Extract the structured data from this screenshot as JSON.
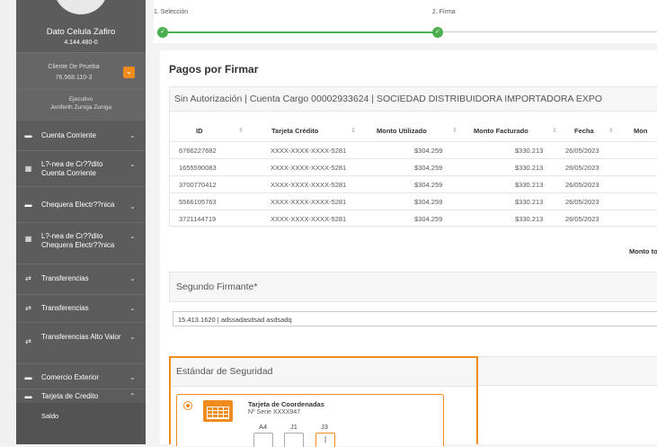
{
  "sidebar": {
    "user_name": "Dato Celula Zafiro",
    "user_rut": "4.144.480-0",
    "client_label": "Cliente De Prueba",
    "client_rut": "76.568.110-3",
    "client_toggle_icon": "⌄",
    "exec_label": "Ejecutivo",
    "exec_name": "Jeniferth Zuniga Zuniga",
    "items": [
      {
        "label": "Cuenta Corriente",
        "icon": "wallet-icon",
        "glyph": "▬",
        "chevron": "⌄"
      },
      {
        "label": "L?-nea de Cr??dito Cuenta Corriente",
        "icon": "grid-icon",
        "glyph": "▦",
        "chevron": "⌄"
      },
      {
        "label": "Chequera Electr??nica",
        "icon": "wallet-icon",
        "glyph": "▬",
        "chevron": "⌄"
      },
      {
        "label": "L?-nea de Cr??dito Chequera Electr??nica",
        "icon": "grid-icon",
        "glyph": "▦",
        "chevron": "⌄"
      },
      {
        "label": "Transferencias",
        "icon": "transfer-icon",
        "glyph": "⇄",
        "chevron": "⌄"
      },
      {
        "label": "Transferencias",
        "icon": "transfer-icon",
        "glyph": "⇄",
        "chevron": "⌄"
      },
      {
        "label": "Transferencias Alto Valor",
        "icon": "transfer-icon",
        "glyph": "⇄",
        "chevron": "⌄"
      },
      {
        "label": "Comercio Exterior",
        "icon": "wallet-icon",
        "glyph": "▬",
        "chevron": "⌄"
      },
      {
        "label": "Tarjeta de Credito",
        "icon": "wallet-icon",
        "glyph": "▬",
        "chevron": "⌃"
      }
    ],
    "sub_item": "Saldo"
  },
  "steps": {
    "step1": "1. Selección",
    "step2": "2. Firma",
    "check": "✓"
  },
  "main": {
    "title": "Pagos por Firmar",
    "account_header": "Sin Autorización | Cuenta Cargo 00002933624 | SOCIEDAD DISTRIBUIDORA IMPORTADORA EXPO",
    "sort_glyph": "⇕",
    "columns": [
      "ID",
      "Tarjeta Crédito",
      "Monto Utilizado",
      "Monto Facturado",
      "Fecha",
      "Mon"
    ],
    "rows": [
      [
        "6766227682",
        "XXXX-XXXX-XXXX-5281",
        "$304.259",
        "$330.213",
        "26/05/2023"
      ],
      [
        "1655590083",
        "XXXX-XXXX-XXXX-5281",
        "$304.259",
        "$330.213",
        "26/05/2023"
      ],
      [
        "3700770412",
        "XXXX-XXXX-XXXX-5281",
        "$304.259",
        "$330.213",
        "26/05/2023"
      ],
      [
        "5566105763",
        "XXXX-XXXX-XXXX-5281",
        "$304.259",
        "$330.213",
        "26/05/2023"
      ],
      [
        "3721144719",
        "XXXX-XXXX-XXXX-5281",
        "$304.259",
        "$330.213",
        "26/05/2023"
      ]
    ],
    "monto_total": "Monto to"
  },
  "firmante": {
    "title": "Segundo Firmante*",
    "value": "15.413.1620 | adssadasdsad asdsadq"
  },
  "security": {
    "title": "Estándar de Seguridad",
    "card_title": "Tarjeta de Coordenadas",
    "card_serie": "Nº Serie XXXX947",
    "coords": [
      "A4",
      "J1",
      "J3"
    ],
    "coord_values": [
      "",
      "",
      "|"
    ]
  },
  "colors": {
    "accent": "#f08c1e",
    "success": "#4caf50",
    "sidebar": "#5c5c5c"
  }
}
